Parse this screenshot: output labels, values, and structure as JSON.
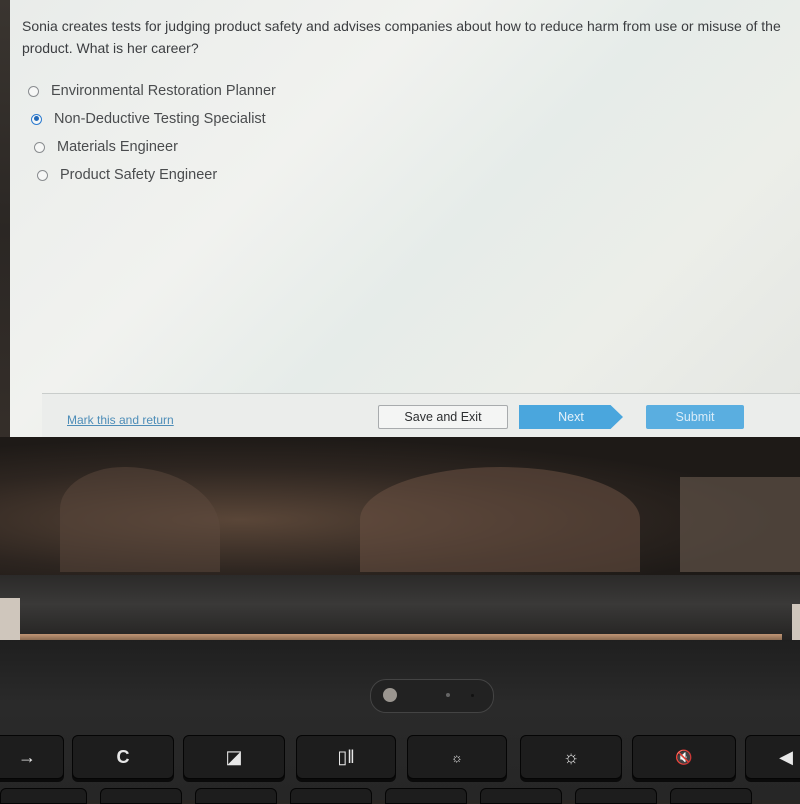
{
  "question": {
    "text": "Sonia creates tests for judging product safety and advises companies about how to reduce harm from use or misuse of the product. What is her career?"
  },
  "options": [
    {
      "label": "Environmental Restoration Planner",
      "selected": false
    },
    {
      "label": "Non-Deductive Testing Specialist",
      "selected": true
    },
    {
      "label": "Materials Engineer",
      "selected": false
    },
    {
      "label": "Product Safety Engineer",
      "selected": false
    }
  ],
  "footer": {
    "mark_link": "Mark this and return",
    "save_exit": "Save and Exit",
    "next": "Next",
    "submit": "Submit"
  },
  "colors": {
    "accent": "#4aa6dd",
    "link": "#4d8db8",
    "radio_selected": "#2268b8"
  },
  "keyboard": {
    "keys": [
      {
        "name": "forward-key",
        "glyph": "→"
      },
      {
        "name": "refresh-key",
        "glyph": "C"
      },
      {
        "name": "fullscreen-key",
        "glyph": "◪"
      },
      {
        "name": "overview-key",
        "glyph": "▯‖"
      },
      {
        "name": "brightness-down-key",
        "glyph": "☼"
      },
      {
        "name": "brightness-up-key",
        "glyph": "☼"
      },
      {
        "name": "mute-key",
        "glyph": "🔇"
      },
      {
        "name": "volume-key",
        "glyph": "◀"
      }
    ]
  }
}
